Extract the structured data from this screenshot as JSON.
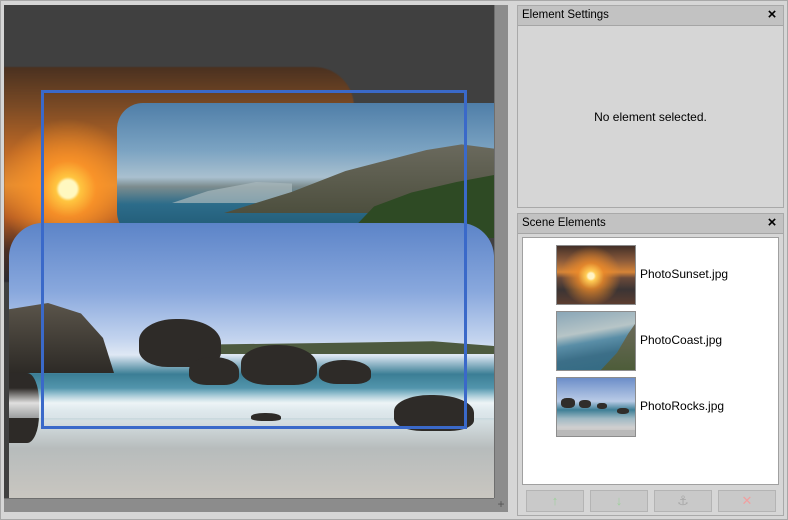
{
  "canvas": {
    "selection_color": "#3a69c9",
    "corner_glyph": "+"
  },
  "panels": {
    "element_settings": {
      "title": "Element Settings",
      "close_glyph": "×",
      "empty_message": "No element selected."
    },
    "scene_elements": {
      "title": "Scene Elements",
      "close_glyph": "×",
      "items": [
        {
          "label": "PhotoSunset.jpg",
          "thumb": "sunset"
        },
        {
          "label": "PhotoCoast.jpg",
          "thumb": "coast"
        },
        {
          "label": "PhotoRocks.jpg",
          "thumb": "rocks"
        }
      ],
      "buttons": [
        {
          "name": "move-up",
          "icon": "arrow-up-icon",
          "glyph": "↑"
        },
        {
          "name": "move-down",
          "icon": "arrow-down-icon",
          "glyph": "↓"
        },
        {
          "name": "anchor",
          "icon": "anchor-icon",
          "glyph": "⚓"
        },
        {
          "name": "delete",
          "icon": "delete-icon",
          "glyph": "✕"
        }
      ]
    }
  }
}
